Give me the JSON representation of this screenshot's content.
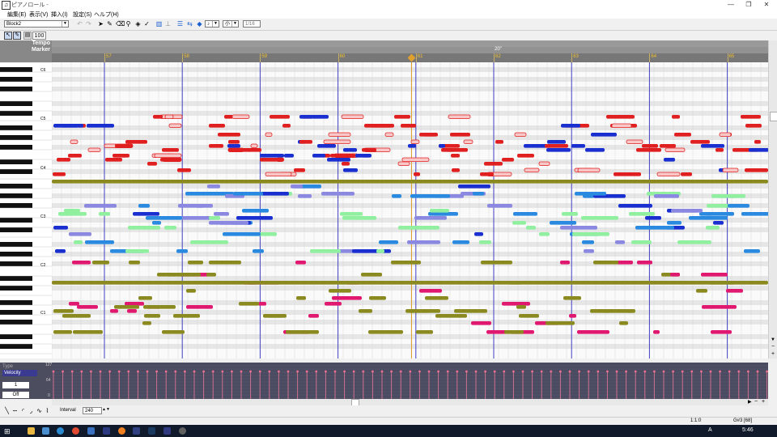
{
  "window": {
    "title": "ピアノロール -",
    "app_icon": "piano-roll-icon"
  },
  "window_buttons": {
    "minimize": "—",
    "maximize": "❐",
    "close": "✕"
  },
  "menu": [
    {
      "label": "編集(E)"
    },
    {
      "label": "表示(V)"
    },
    {
      "label": "挿入(I)"
    },
    {
      "label": "設定(S)"
    },
    {
      "label": "ヘルプ(H)"
    }
  ],
  "toolbar": {
    "block_select": "Block2",
    "velocity_value": "100",
    "tool_icons": [
      "undo-icon",
      "redo-icon",
      "select-icon",
      "pencil-icon",
      "eraser-icon",
      "split-icon",
      "glue-icon",
      "mute-icon",
      "grid-icon",
      "quantize-icon",
      "snap-icon",
      "loop-icon",
      "note-length-icon"
    ],
    "note_combo": "♪",
    "grid_combo": "小",
    "length_field": "1/16"
  },
  "ruler": {
    "tempo_label": "Tempo",
    "marker_label": "Marker",
    "measures": [
      "57",
      "58",
      "59",
      "60",
      "61",
      "62",
      "63",
      "64",
      "65"
    ],
    "time_marker": "20\""
  },
  "keyboard": {
    "octave_labels": [
      "C6",
      "C5",
      "C4",
      "C3",
      "C2",
      "C1"
    ]
  },
  "velocity_panel": {
    "type_label": "Type",
    "type_value": "Velocity",
    "scale_labels": [
      "127",
      "64",
      "0"
    ],
    "channel_value": "1",
    "mode_value": "Off"
  },
  "bottom": {
    "interval_label": "Interval",
    "interval_value": "240"
  },
  "status": {
    "position": "1:1:0",
    "note": "G#3 [68]"
  },
  "taskbar": {
    "time": "5:46",
    "ime": "A"
  },
  "colors": {
    "red": "#e02020",
    "pink_outline": "#e89090",
    "blue": "#1a2fd0",
    "sky": "#2a8ae0",
    "lavender": "#8a88e0",
    "mint": "#90f0a0",
    "olive": "#8a8a20",
    "magenta": "#e01870",
    "measure_line": "#4040c0",
    "playhead": "#e0a030"
  }
}
